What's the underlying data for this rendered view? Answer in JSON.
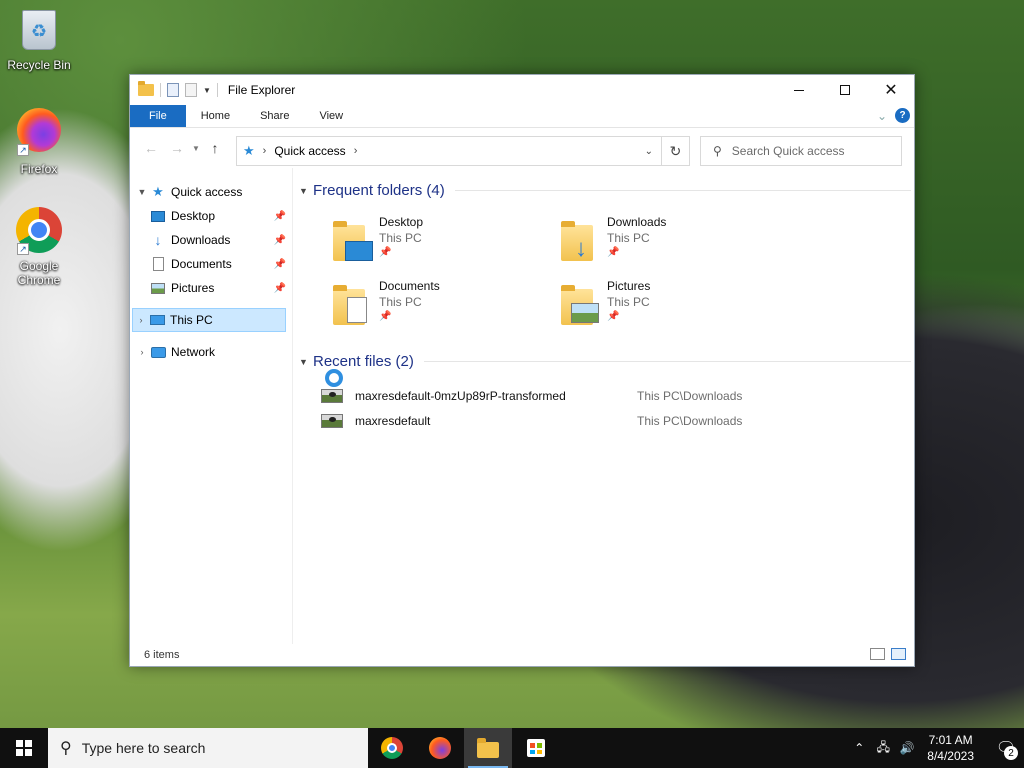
{
  "desktop": {
    "icons": [
      {
        "label": "Recycle Bin",
        "icon": "recycle-bin-icon"
      },
      {
        "label": "Firefox",
        "icon": "firefox-icon"
      },
      {
        "label": "Google Chrome",
        "icon": "chrome-icon"
      }
    ]
  },
  "window": {
    "title": "File Explorer",
    "ribbon_tabs": [
      "File",
      "Home",
      "Share",
      "View"
    ],
    "help_label": "?",
    "address": {
      "location": "Quick access"
    },
    "search_placeholder": "Search Quick access"
  },
  "nav_pane": {
    "items": [
      {
        "label": "Quick access",
        "icon": "quick-access-star-icon",
        "pinned": false
      },
      {
        "label": "Desktop",
        "icon": "desktop-icon",
        "pinned": true
      },
      {
        "label": "Downloads",
        "icon": "downloads-icon",
        "pinned": true
      },
      {
        "label": "Documents",
        "icon": "documents-icon",
        "pinned": true
      },
      {
        "label": "Pictures",
        "icon": "pictures-icon",
        "pinned": true
      },
      {
        "label": "This PC",
        "icon": "this-pc-icon",
        "selected": true
      },
      {
        "label": "Network",
        "icon": "network-icon"
      }
    ]
  },
  "main": {
    "frequent_header": "Frequent folders (4)",
    "folders": [
      {
        "name": "Desktop",
        "location": "This PC"
      },
      {
        "name": "Downloads",
        "location": "This PC"
      },
      {
        "name": "Documents",
        "location": "This PC"
      },
      {
        "name": "Pictures",
        "location": "This PC"
      }
    ],
    "recent_header": "Recent files (2)",
    "recent_files": [
      {
        "name": "maxresdefault-0mzUp89rP-transformed",
        "path": "This PC\\Downloads"
      },
      {
        "name": "maxresdefault",
        "path": "This PC\\Downloads"
      }
    ]
  },
  "status": {
    "item_count": "6 items"
  },
  "taskbar": {
    "search_placeholder": "Type here to search",
    "apps": [
      "chrome-icon",
      "firefox-icon",
      "file-explorer-icon",
      "microsoft-store-icon"
    ],
    "time": "7:01 AM",
    "date": "8/4/2023",
    "notification_count": "2"
  },
  "colors": {
    "accent": "#1a6cc2",
    "group_header": "#1e3287",
    "selection": "#cce8ff"
  }
}
